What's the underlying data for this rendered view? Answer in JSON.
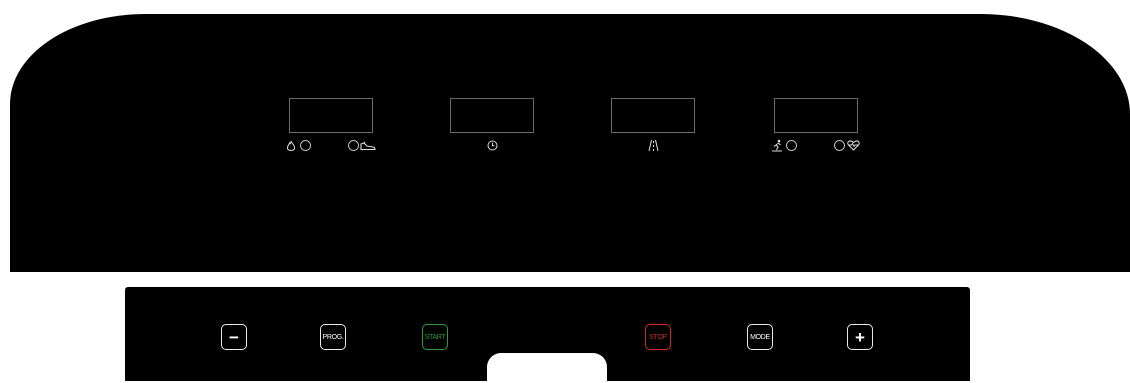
{
  "console": {
    "displays": [
      {
        "name": "calories-distance-display",
        "left_icon": "flame-icon",
        "right_icon": "shoe-icon"
      },
      {
        "name": "time-display",
        "icon": "clock-icon"
      },
      {
        "name": "incline-display",
        "icon": "road-icon"
      },
      {
        "name": "speed-pulse-display",
        "left_icon": "runner-icon",
        "right_icon": "heart-pulse-icon"
      }
    ]
  },
  "keypad": {
    "minus": {
      "label": "−",
      "icon": "minus-icon"
    },
    "prog": {
      "label": "PROG."
    },
    "start": {
      "label": "START",
      "color": "#2e9b3a"
    },
    "stop": {
      "label": "STOP",
      "color": "#d42a20"
    },
    "mode": {
      "label": "MODE"
    },
    "plus": {
      "label": "+",
      "icon": "plus-icon"
    }
  }
}
